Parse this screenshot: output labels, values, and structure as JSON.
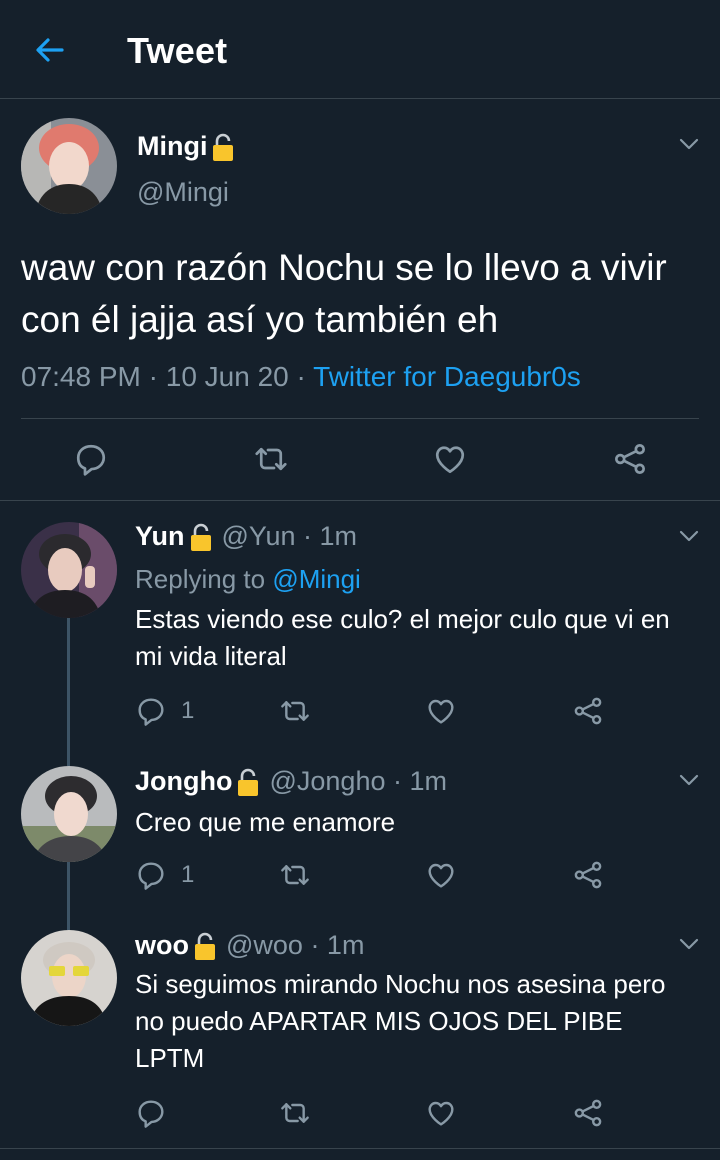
{
  "header": {
    "title": "Tweet",
    "back_icon": "arrow-left-icon"
  },
  "main_tweet": {
    "name": "Mingi",
    "handle": "@Mingi",
    "text": "waw con razón Nochu se lo llevo a vivir con él jajja así yo también eh",
    "time": "07:48 PM",
    "sep1": " · ",
    "date": "10 Jun 20",
    "sep2": " · ",
    "source": "Twitter for Daegubr0s"
  },
  "replies": [
    {
      "name": "Yun",
      "handle": "@Yun · 1m",
      "replying_prefix": "Replying to ",
      "replying_to": "@Mingi",
      "text": "Estas viendo ese culo? el mejor culo que vi en mi vida literal",
      "reply_count": "1"
    },
    {
      "name": "Jongho",
      "handle": "@Jongho · 1m",
      "text": "Creo que me enamore",
      "reply_count": "1"
    },
    {
      "name": "woo",
      "handle": "@woo · 1m",
      "text": "Si seguimos mirando Nochu nos asesina pero no puedo APARTAR MIS OJOS DEL PIBE LPTM",
      "reply_count": ""
    }
  ],
  "colors": {
    "background": "#15202b",
    "accent": "#1da1f2",
    "secondary_text": "#8899a6",
    "divider": "#38444d",
    "lock": "#f9c52c"
  }
}
